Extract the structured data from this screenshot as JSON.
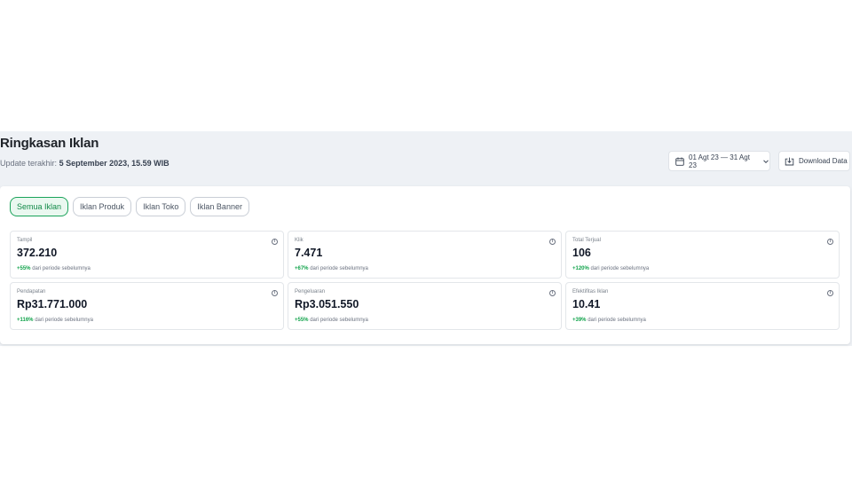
{
  "header": {
    "title": "Ringkasan Iklan",
    "update_prefix": "Update terakhir:",
    "update_value": "5 September 2023, 15.59 WIB"
  },
  "controls": {
    "date_range": "01 Agt 23 — 31 Agt 23",
    "download_label": "Download Data"
  },
  "tabs": [
    {
      "label": "Semua Iklan",
      "active": true
    },
    {
      "label": "Iklan Produk",
      "active": false
    },
    {
      "label": "Iklan Toko",
      "active": false
    },
    {
      "label": "Iklan Banner",
      "active": false
    }
  ],
  "metrics": [
    {
      "label": "Tampil",
      "value": "372.210",
      "change": "+55%",
      "change_text": "dari periode sebelumnya"
    },
    {
      "label": "Klik",
      "value": "7.471",
      "change": "+67%",
      "change_text": "dari periode sebelumnya"
    },
    {
      "label": "Total Terjual",
      "value": "106",
      "change": "+120%",
      "change_text": "dari periode sebelumnya"
    },
    {
      "label": "Pendapatan",
      "value": "Rp31.771.000",
      "change": "+116%",
      "change_text": "dari periode sebelumnya"
    },
    {
      "label": "Pengeluaran",
      "value": "Rp3.051.550",
      "change": "+55%",
      "change_text": "dari periode sebelumnya"
    },
    {
      "label": "Efektifitas Iklan",
      "value": "10.41",
      "change": "+39%",
      "change_text": "dari periode sebelumnya"
    }
  ],
  "colors": {
    "accent_green": "#11a34b",
    "band_background": "#eef1f5"
  },
  "icons": {
    "date": "calendar-icon",
    "date_dropdown": "chevron-down-icon",
    "download": "download-icon",
    "metric_info": "info-icon"
  }
}
